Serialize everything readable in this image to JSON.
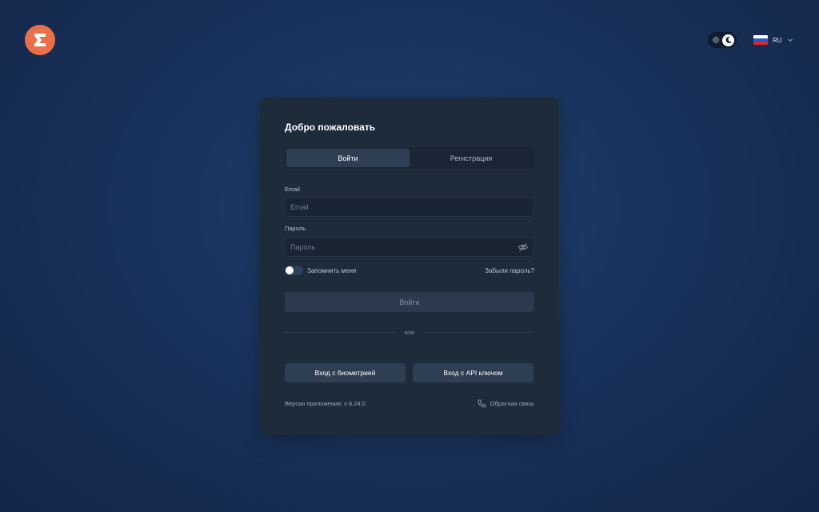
{
  "header": {
    "logo_icon": "exness-logo-icon",
    "theme_toggle": {
      "icons": [
        "sun-icon",
        "moon-icon"
      ],
      "mode": "dark"
    },
    "language": {
      "code": "RU",
      "flag_icon": "russia-flag-icon"
    }
  },
  "card": {
    "title": "Добро пожаловать",
    "tabs": [
      {
        "label": "Войти",
        "active": true
      },
      {
        "label": "Регистрация",
        "active": false
      }
    ],
    "email": {
      "label": "Email",
      "placeholder": "Email",
      "value": ""
    },
    "password": {
      "label": "Пароль",
      "placeholder": "Пароль",
      "value": "",
      "toggle_icon": "eye-hidden-icon"
    },
    "remember_me": {
      "label": "Запомнить меня",
      "checked": false
    },
    "forgot_password": "Забыли пароль?",
    "submit_label": "Войти",
    "divider_text": "или",
    "biometric_button": "Вход с биометрией",
    "api_key_button": "Вход с API ключом",
    "version_text": "Версия приложения: v 6.24.0",
    "feedback": {
      "label": "Обратная связь",
      "icon": "phone-icon"
    }
  },
  "colors": {
    "brand": "#e9704a",
    "card_bg": "#1e2b3b",
    "button_bg": "#2e3e53",
    "page_bg": "#1a3560"
  }
}
